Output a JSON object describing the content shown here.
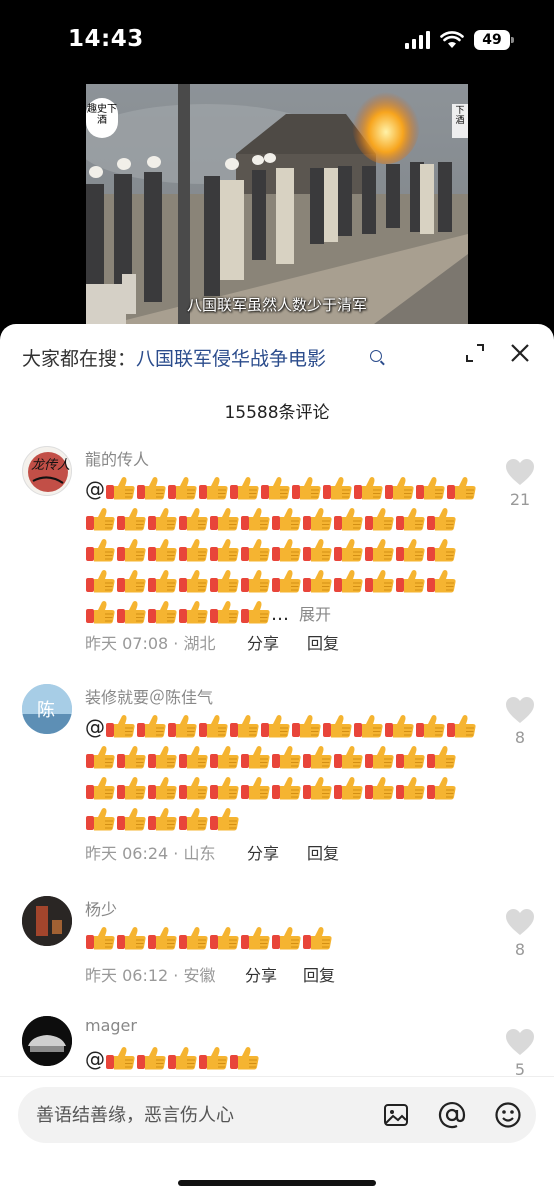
{
  "status": {
    "time": "14:43",
    "battery": "49"
  },
  "video": {
    "subtitle": "八国联军虽然人数少于清军",
    "logo_text": "趣史下酒",
    "logo_right": "下酒"
  },
  "panel": {
    "search_prefix": "大家都在搜：",
    "search_term": "八国联军侵华战争电影",
    "comment_count": "15588条评论"
  },
  "comments": [
    {
      "user": "龍的传人",
      "avatar_text": "龙传人",
      "time": "昨天 07:08 · 湖北",
      "share": "分享",
      "reply": "回复",
      "likes": "21",
      "expand": "展开",
      "emoji_count": 54
    },
    {
      "user": "装修就要＠陈佳气",
      "avatar_text": "陈",
      "time": "昨天 06:24 · 山东",
      "share": "分享",
      "reply": "回复",
      "likes": "8",
      "emoji_count": 41
    },
    {
      "user": "杨少",
      "time": "昨天 06:12 · 安徽",
      "share": "分享",
      "reply": "回复",
      "likes": "8",
      "emoji_count": 8
    },
    {
      "user": "mager",
      "likes": "5",
      "emoji_count": 5
    }
  ],
  "input": {
    "placeholder": "善语结善缘，恶言伤人心"
  },
  "icons": {
    "like": "heart-icon",
    "emoji": "thumbs-up-emoji",
    "image": "image-icon",
    "mention": "at-icon",
    "smiley": "emoji-face-icon"
  },
  "colors": {
    "link": "#2b4c8c",
    "emoji": "#f5b431",
    "cuff": "#e8453a"
  }
}
